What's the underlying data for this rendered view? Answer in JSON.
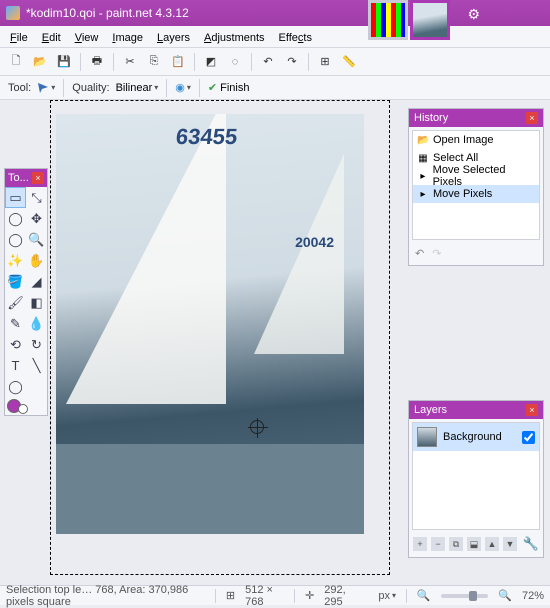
{
  "window": {
    "title": "*kodim10.qoi - paint.net 4.3.12"
  },
  "menu": {
    "file": "File",
    "edit": "Edit",
    "view": "View",
    "image": "Image",
    "layers": "Layers",
    "adjustments": "Adjustments",
    "effects": "Effects"
  },
  "toolbar2": {
    "tool_label": "Tool:",
    "quality_label": "Quality:",
    "quality_value": "Bilinear",
    "finish": "Finish"
  },
  "tools_panel": {
    "title": "To...",
    "close": "×"
  },
  "history": {
    "title": "History",
    "items": [
      {
        "icon": "📂",
        "label": "Open Image"
      },
      {
        "icon": "▦",
        "label": "Select All"
      },
      {
        "icon": "▸",
        "label": "Move Selected Pixels"
      },
      {
        "icon": "▸",
        "label": "Move Pixels"
      }
    ],
    "selected": 3
  },
  "layers": {
    "title": "Layers",
    "items": [
      {
        "name": "Background",
        "visible": true
      }
    ]
  },
  "canvas": {
    "sailnum": "63455",
    "sailnum_small": "20042"
  },
  "status": {
    "selection": "Selection top le… 768, Area: 370,986 pixels square",
    "dims": "512 × 768",
    "cursor": "292, 295",
    "unit": "px",
    "zoom": "72%"
  }
}
